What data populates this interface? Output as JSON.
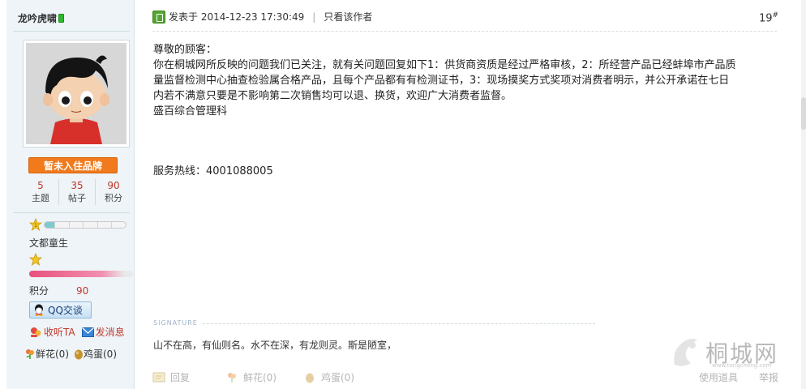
{
  "user": {
    "name": "龙吟虎啸",
    "brand_badge": "暂未入住品牌",
    "stats": [
      {
        "value": "5",
        "label": "主题"
      },
      {
        "value": "35",
        "label": "帖子"
      },
      {
        "value": "90",
        "label": "积分"
      }
    ],
    "level_badge": "1",
    "level_progress_percent": 12,
    "rank": "文都童生",
    "score_label": "积分",
    "score_value": "90",
    "qq_label": "QQ交谈",
    "follow_label": "收听TA",
    "message_label": "发消息",
    "flower_label": "鲜花(0)",
    "egg_label": "鸡蛋(0)"
  },
  "post": {
    "posted_prefix": "发表于",
    "posted_time": "2014-12-23 17:30:49",
    "only_author": "只看该作者",
    "floor": "19",
    "floor_sup": "#",
    "lines": [
      "尊敬的顾客：",
      "你在桐城网所反映的问题我们已关注，就有关问题回复如下1：供货商资质是经过严格审核，2：所经营产品已经蚌埠市产品质",
      "量监督检测中心抽查检验属合格产品，且每个产品都有有检测证书，3：现场摸奖方式奖项对消费者明示，并公开承诺在七日",
      "内若不满意只要是不影响第二次销售均可以退、换货，欢迎广大消费者监督。",
      "盛百综合管理科"
    ],
    "hotline": "服务热线：4001088005",
    "signature_title": "SIGNATURE",
    "signature": "山不在高，有仙则名。水不在深，有龙则灵。斯是陋室，"
  },
  "actions": {
    "reply": "回复",
    "flower": "鲜花(0)",
    "egg": "鸡蛋(0)",
    "tools": "使用道具",
    "report": "举报"
  },
  "watermark": {
    "text": "桐城网",
    "url": "www.tongcheng.com"
  },
  "colors": {
    "accent_orange": "#f07a1c",
    "number_red": "#c0392b",
    "panel_bg": "#eef4f8"
  }
}
